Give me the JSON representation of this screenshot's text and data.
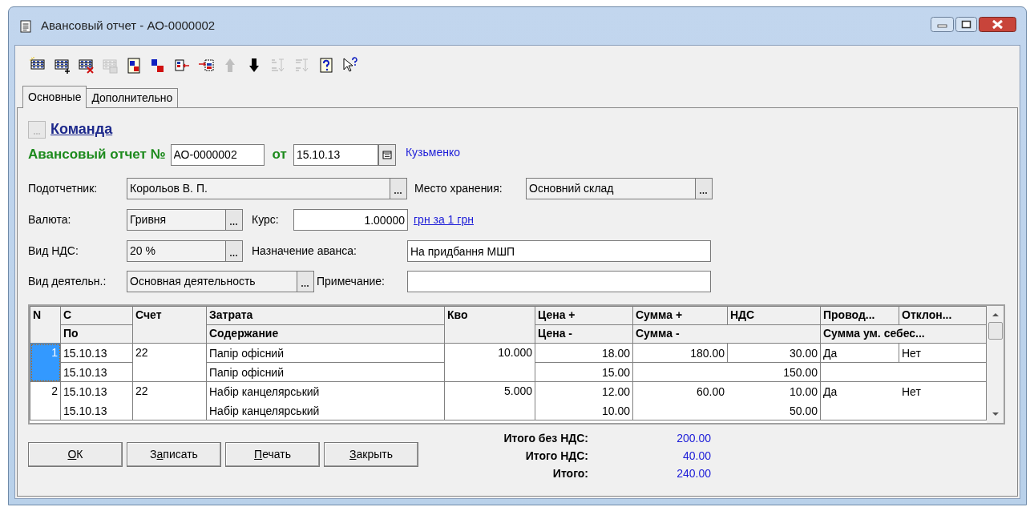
{
  "window": {
    "title": "Авансовый отчет - АО-0000002"
  },
  "toolbar": [
    {
      "kind": "new",
      "disabled": false
    },
    {
      "kind": "add",
      "disabled": false
    },
    {
      "kind": "delete",
      "disabled": false
    },
    {
      "kind": "copy",
      "disabled": true
    },
    {
      "kind": "dkdoc",
      "disabled": false
    },
    {
      "kind": "dk",
      "disabled": false
    },
    {
      "kind": "moveleft",
      "disabled": false
    },
    {
      "kind": "moveright",
      "disabled": false
    },
    {
      "kind": "up",
      "disabled": true
    },
    {
      "kind": "down",
      "disabled": false
    },
    {
      "kind": "sortasc",
      "disabled": true
    },
    {
      "kind": "sortdesc",
      "disabled": true
    },
    {
      "kind": "help",
      "disabled": false
    },
    {
      "kind": "whatis",
      "disabled": false
    }
  ],
  "tabs": [
    {
      "label": "Основные",
      "selected": true
    },
    {
      "label": "Дополнительно",
      "selected": false
    }
  ],
  "header": {
    "command_link": "Команда",
    "doc_label": "Авансовый отчет №",
    "number": "АО-0000002",
    "date_label": "от",
    "date": "15.10.13",
    "author": "Кузьменко"
  },
  "form": {
    "accountable": {
      "label": "Подотчетник:",
      "value": "Корольов В. П."
    },
    "warehouse": {
      "label": "Место хранения:",
      "value": "Основний склад"
    },
    "currency": {
      "label": "Валюта:",
      "value": "Гривня"
    },
    "rate": {
      "label": "Курс:",
      "value": "1.00000",
      "unit_link": "грн за 1 грн"
    },
    "vat_type": {
      "label": "Вид НДС:",
      "value": "20 %"
    },
    "purpose": {
      "label": "Назначение аванса:",
      "value": "На придбання МШП"
    },
    "activity": {
      "label": "Вид деятельн.:",
      "value": "Основная деятельность"
    },
    "note": {
      "label": "Примечание:"
    }
  },
  "table": {
    "columns": [
      {
        "top": "N"
      },
      {
        "top": "С",
        "bottom": "По"
      },
      {
        "top": "Счет"
      },
      {
        "top": "Затрата",
        "bottom": "Содержание"
      },
      {
        "top": "Кво"
      },
      {
        "top": "Цена +",
        "bottom": "Цена -"
      }
    ],
    "column_groups": [
      {
        "tops": [
          "Сумма +",
          "НДС"
        ],
        "bottom": "Сумма -"
      },
      {
        "tops": [
          "Провод...",
          "Отклон..."
        ],
        "bottom": "Сумма ум. себес..."
      }
    ],
    "rows": [
      {
        "n": "1",
        "selected": true,
        "from": "15.10.13",
        "to": "15.10.13",
        "account": "22",
        "expense": "Папір офісний",
        "content": "Папір офісний",
        "qty": "10.000",
        "price_plus": "18.00",
        "price_minus": "15.00",
        "sum_plus": "180.00",
        "vat": "30.00",
        "sum_minus": "150.00",
        "posting": "Да",
        "deviation": "Нет"
      },
      {
        "n": "2",
        "selected": false,
        "from": "15.10.13",
        "to": "15.10.13",
        "account": "22",
        "expense": "Набір канцелярський",
        "content": "Набір канцелярський",
        "qty": "5.000",
        "price_plus": "12.00",
        "price_minus": "10.00",
        "sum_plus": "60.00",
        "vat": "10.00",
        "sum_minus": "50.00",
        "posting": "Да",
        "deviation": "Нет"
      }
    ]
  },
  "buttons": [
    {
      "key": "О",
      "post": "К"
    },
    {
      "pre": "З",
      "key": "а",
      "post": "писать"
    },
    {
      "key": "П",
      "post": "ечать"
    },
    {
      "key": "З",
      "post": "акрыть"
    }
  ],
  "totals": [
    {
      "label": "Итого без НДС:",
      "value": "200.00"
    },
    {
      "label": "Итого НДС:",
      "value": "40.00"
    },
    {
      "label": "Итого:",
      "value": "240.00"
    }
  ]
}
